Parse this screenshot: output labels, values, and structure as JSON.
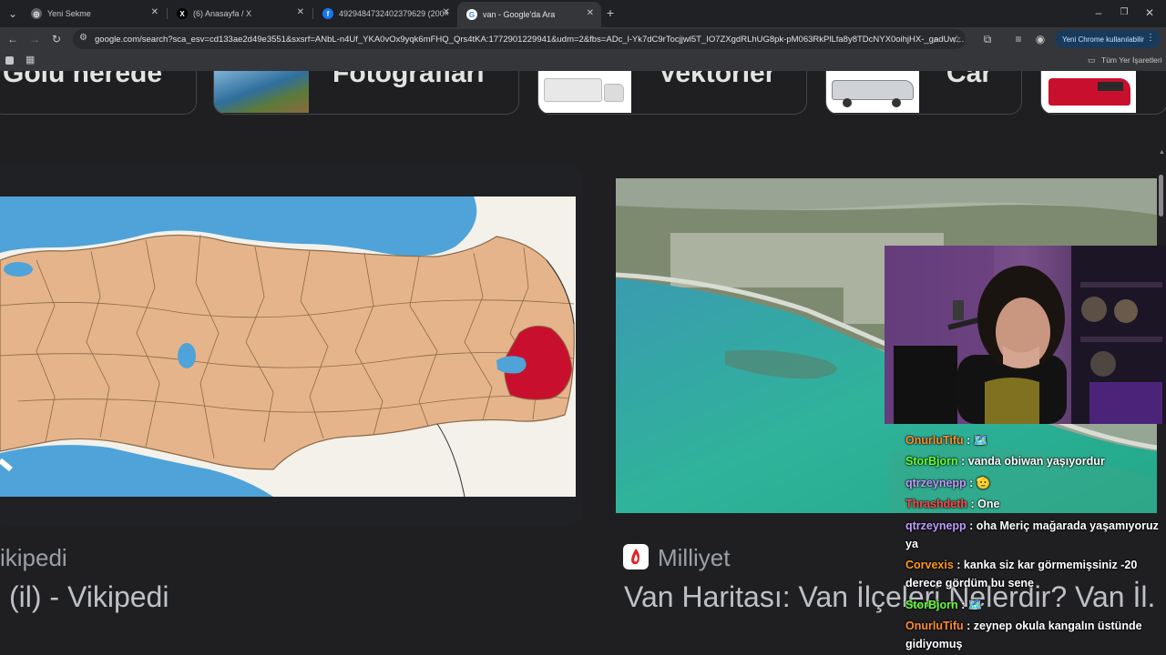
{
  "browser": {
    "tabs": [
      {
        "title": "Yeni Sekme",
        "icon": "chrome-icon",
        "active": false
      },
      {
        "title": "(6) Anasayfa / X",
        "icon": "x-logo-icon",
        "active": false
      },
      {
        "title": "4929484732402379629 (200×2…",
        "icon": "facebook-icon",
        "active": false
      },
      {
        "title": "van - Google'da Ara",
        "icon": "google-icon",
        "active": true
      }
    ],
    "url": "google.com/search?sca_esv=cd133ae2d49e3551&sxsrf=ANbL-n4Uf_YKA0vOx9yqk6mFHQ_Qrs4tKA:1772901229941&udm=2&fbs=ADc_l-Yk7dC9rTocjjwl5T_IO7ZXgdRLhUG8pk-pM063RkPlLfa8y8TDcNYX0oihjHX-_gadUw…",
    "new_chrome_label": "Yeni Chrome kullanılabilir",
    "bookmarks_all": "Tüm Yer İşaretleri"
  },
  "chips": [
    {
      "label": "Gölü nerede"
    },
    {
      "label": "Fotoğrafları"
    },
    {
      "label": "Vektörler"
    },
    {
      "label": "Car"
    }
  ],
  "results": [
    {
      "source": "ikipedi",
      "title": "(il) - Vikipedi"
    },
    {
      "source": "Milliyet",
      "title": "Van Haritası: Van İlçeleri Nelerdir? Van İl."
    }
  ],
  "chat": [
    {
      "user": "OnurluTifu",
      "text": ": 🗺️",
      "color": "#ff8c2e"
    },
    {
      "user": "StorBjorn",
      "text": ": vanda obiwan yaşıyordur",
      "color": "#66ff33"
    },
    {
      "user": "qtrzeynepp",
      "text": ": 🫡",
      "color": "#c09bff"
    },
    {
      "user": "Thrashdeth",
      "text": ": One",
      "color": "#ff4a4a"
    },
    {
      "user": "qtrzeynepp",
      "text": ": oha Meriç mağarada yaşamıyoruz ya",
      "color": "#c09bff"
    },
    {
      "user": "Corvexis",
      "text": ": kanka siz kar görmemişsiniz -20 derece gördüm bu sene",
      "color": "#ff9a1f"
    },
    {
      "user": "StorBjorn",
      "text": ": 🗺️",
      "color": "#66ff33"
    },
    {
      "user": "OnurluTifu",
      "text": ": zeynep okula kangalın üstünde gidiyomuş",
      "color": "#ff8c2e"
    }
  ]
}
